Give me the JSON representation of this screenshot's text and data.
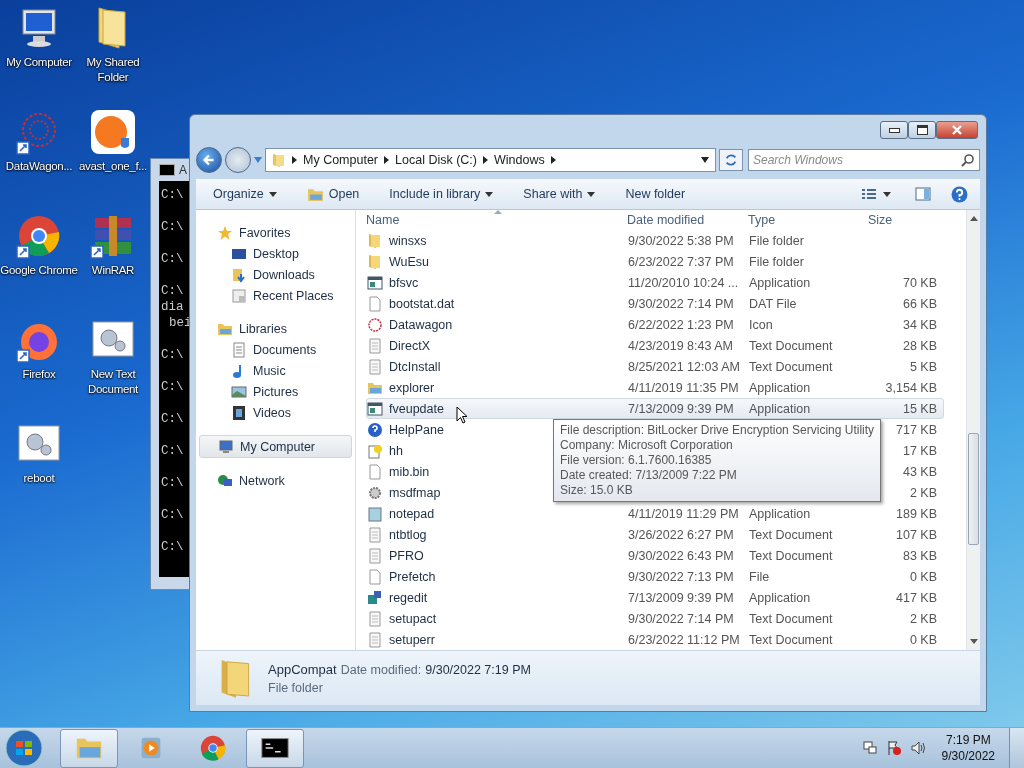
{
  "desktop_icons": [
    {
      "label": "My Computer",
      "kind": "computer"
    },
    {
      "label": "My Shared Folder",
      "kind": "folder"
    },
    {
      "label": "DataWagon...",
      "kind": "datawagon"
    },
    {
      "label": "avast_one_f...",
      "kind": "avast"
    },
    {
      "label": "Google Chrome",
      "kind": "chrome"
    },
    {
      "label": "WinRAR",
      "kind": "winrar"
    },
    {
      "label": "Firefox",
      "kind": "firefox"
    },
    {
      "label": "New Text Document",
      "kind": "script"
    },
    {
      "label": "reboot",
      "kind": "script"
    }
  ],
  "console": {
    "title": "A",
    "lines": [
      {
        "text": "C:\\",
        "kind": "prompt"
      },
      {
        "text": "C:\\",
        "kind": "prompt"
      },
      {
        "text": "C:\\",
        "kind": "prompt"
      },
      {
        "text": "C:\\",
        "kind": "prompt"
      },
      {
        "text": "dia",
        "kind": "output"
      },
      {
        "text": "bei",
        "kind": "continuation"
      },
      {
        "text": "C:\\",
        "kind": "prompt"
      },
      {
        "text": "C:\\",
        "kind": "prompt"
      },
      {
        "text": "C:\\",
        "kind": "prompt"
      },
      {
        "text": "C:\\",
        "kind": "prompt"
      },
      {
        "text": "C:\\",
        "kind": "prompt"
      },
      {
        "text": "C:\\",
        "kind": "prompt"
      },
      {
        "text": "C:\\",
        "kind": "prompt"
      }
    ]
  },
  "explorer": {
    "breadcrumb": [
      "My Computer",
      "Local Disk (C:)",
      "Windows"
    ],
    "search": {
      "placeholder": "Search Windows"
    },
    "toolbar": [
      {
        "label": "Organize",
        "dropdown": true,
        "kind": "menu"
      },
      {
        "label": "Open",
        "dropdown": false,
        "kind": "open"
      },
      {
        "label": "Include in library",
        "dropdown": true,
        "kind": "menu"
      },
      {
        "label": "Share with",
        "dropdown": true,
        "kind": "menu"
      },
      {
        "label": "New folder",
        "dropdown": false,
        "kind": "menu"
      }
    ],
    "sidebar": [
      {
        "label": "Favorites",
        "kind": "star",
        "selected": false,
        "children": [
          {
            "label": "Desktop",
            "kind": "desktop",
            "selected": false
          },
          {
            "label": "Downloads",
            "kind": "downloads",
            "selected": false
          },
          {
            "label": "Recent Places",
            "kind": "recent",
            "selected": false
          }
        ]
      },
      {
        "label": "Libraries",
        "kind": "library",
        "selected": false,
        "children": [
          {
            "label": "Documents",
            "kind": "documents",
            "selected": false
          },
          {
            "label": "Music",
            "kind": "music",
            "selected": false
          },
          {
            "label": "Pictures",
            "kind": "pictures",
            "selected": false
          },
          {
            "label": "Videos",
            "kind": "videos",
            "selected": false
          }
        ]
      },
      {
        "label": "My Computer",
        "kind": "computer",
        "selected": true
      },
      {
        "label": "Network",
        "kind": "network",
        "selected": false
      }
    ],
    "columns": [
      "Name",
      "Date modified",
      "Type",
      "Size"
    ],
    "rows": [
      {
        "name": "winsxs",
        "date": "9/30/2022 5:38 PM",
        "type": "File folder",
        "kind": "folder",
        "selected": false
      },
      {
        "name": "WuEsu",
        "date": "6/23/2022 7:37 PM",
        "type": "File folder",
        "kind": "folder",
        "selected": false
      },
      {
        "name": "bfsvc",
        "date": "11/20/2010 10:24 ...",
        "type": "Application",
        "size": "70 KB",
        "kind": "app",
        "selected": false
      },
      {
        "name": "bootstat.dat",
        "date": "9/30/2022 7:14 PM",
        "type": "DAT File",
        "size": "66 KB",
        "kind": "file",
        "selected": false
      },
      {
        "name": "Datawagon",
        "date": "6/22/2022 1:23 PM",
        "type": "Icon",
        "size": "34 KB",
        "kind": "datawagon",
        "selected": false
      },
      {
        "name": "DirectX",
        "date": "4/23/2019 8:43 AM",
        "type": "Text Document",
        "size": "28 KB",
        "kind": "text",
        "selected": false
      },
      {
        "name": "DtcInstall",
        "date": "8/25/2021 12:03 AM",
        "type": "Text Document",
        "size": "5 KB",
        "kind": "text",
        "selected": false
      },
      {
        "name": "explorer",
        "date": "4/11/2019 11:35 PM",
        "type": "Application",
        "size": "3,154 KB",
        "kind": "explorer",
        "selected": false
      },
      {
        "name": "fveupdate",
        "date": "7/13/2009 9:39 PM",
        "type": "Application",
        "size": "15 KB",
        "kind": "app",
        "selected": true
      },
      {
        "name": "HelpPane",
        "size": "717 KB",
        "kind": "help",
        "selected": false
      },
      {
        "name": "hh",
        "size": "17 KB",
        "kind": "hh",
        "selected": false
      },
      {
        "name": "mib.bin",
        "size": "43 KB",
        "kind": "file",
        "selected": false
      },
      {
        "name": "msdfmap",
        "size": "2 KB",
        "kind": "gear",
        "selected": false
      },
      {
        "name": "notepad",
        "date": "4/11/2019 11:29 PM",
        "type": "Application",
        "size": "189 KB",
        "kind": "notepad",
        "selected": false
      },
      {
        "name": "ntbtlog",
        "date": "3/26/2022 6:27 PM",
        "type": "Text Document",
        "size": "107 KB",
        "kind": "text",
        "selected": false
      },
      {
        "name": "PFRO",
        "date": "9/30/2022 6:43 PM",
        "type": "Text Document",
        "size": "83 KB",
        "kind": "text",
        "selected": false
      },
      {
        "name": "Prefetch",
        "date": "9/30/2022 7:13 PM",
        "type": "File",
        "size": "0 KB",
        "kind": "file",
        "selected": false
      },
      {
        "name": "regedit",
        "date": "7/13/2009 9:39 PM",
        "type": "Application",
        "size": "417 KB",
        "kind": "regedit",
        "selected": false
      },
      {
        "name": "setupact",
        "date": "9/30/2022 7:14 PM",
        "type": "Text Document",
        "size": "2 KB",
        "kind": "text",
        "selected": false
      },
      {
        "name": "setuperr",
        "date": "6/23/2022 11:12 PM",
        "type": "Text Document",
        "size": "0 KB",
        "kind": "text",
        "selected": false
      }
    ],
    "tooltip": [
      "File description: BitLocker Drive Encryption Servicing Utility",
      "Company: Microsoft Corporation",
      "File version: 6.1.7600.16385",
      "Date created: 7/13/2009 7:22 PM",
      "Size: 15.0 KB"
    ],
    "details": {
      "name": "AppCompat",
      "date_label": "Date modified:",
      "date": "9/30/2022 7:19 PM",
      "type": "File folder"
    }
  },
  "taskbar": {
    "items": [
      {
        "kind": "explorer",
        "selected": true
      },
      {
        "kind": "media",
        "selected": false
      },
      {
        "kind": "chrome",
        "selected": false
      },
      {
        "kind": "console",
        "selected": true
      }
    ],
    "time": "7:19 PM",
    "date": "9/30/2022"
  }
}
